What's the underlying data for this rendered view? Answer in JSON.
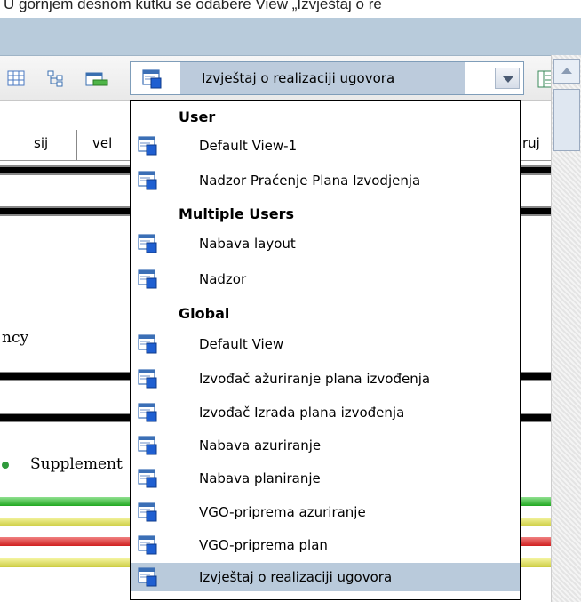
{
  "caption": "U gornjem desnom kutku se odabere View „Izvještaj o re",
  "toolbar": {
    "current_view": "Izvještaj o realizaciji ugovora"
  },
  "gantt": {
    "months": [
      "sij",
      "vel",
      "ruj"
    ],
    "row_labels": [
      "ncy",
      "Supplement"
    ],
    "bar_colors": [
      "#35c335",
      "#e0e060",
      "#e03030",
      "#e0e060"
    ]
  },
  "dropdown": {
    "groups": [
      {
        "label": "User",
        "items": [
          "Default View-1",
          "Nadzor Praćenje Plana Izvodjenja"
        ]
      },
      {
        "label": "Multiple Users",
        "items": [
          "Nabava layout",
          "Nadzor"
        ]
      },
      {
        "label": "Global",
        "items": [
          "Default View",
          "Izvođač ažuriranje plana izvođenja",
          "Izvođač Izrada plana izvođenja",
          "Nabava azuriranje",
          "Nabava planiranje",
          "VGO-priprema azuriranje",
          "VGO-priprema plan",
          "Izvještaj o realizaciji ugovora"
        ]
      }
    ],
    "selected": "Izvještaj o realizaciji ugovora"
  },
  "colors": {
    "selection": "#b9cadb",
    "header_band": "#b8cbdb",
    "icon_blue": "#1f5fd1"
  }
}
